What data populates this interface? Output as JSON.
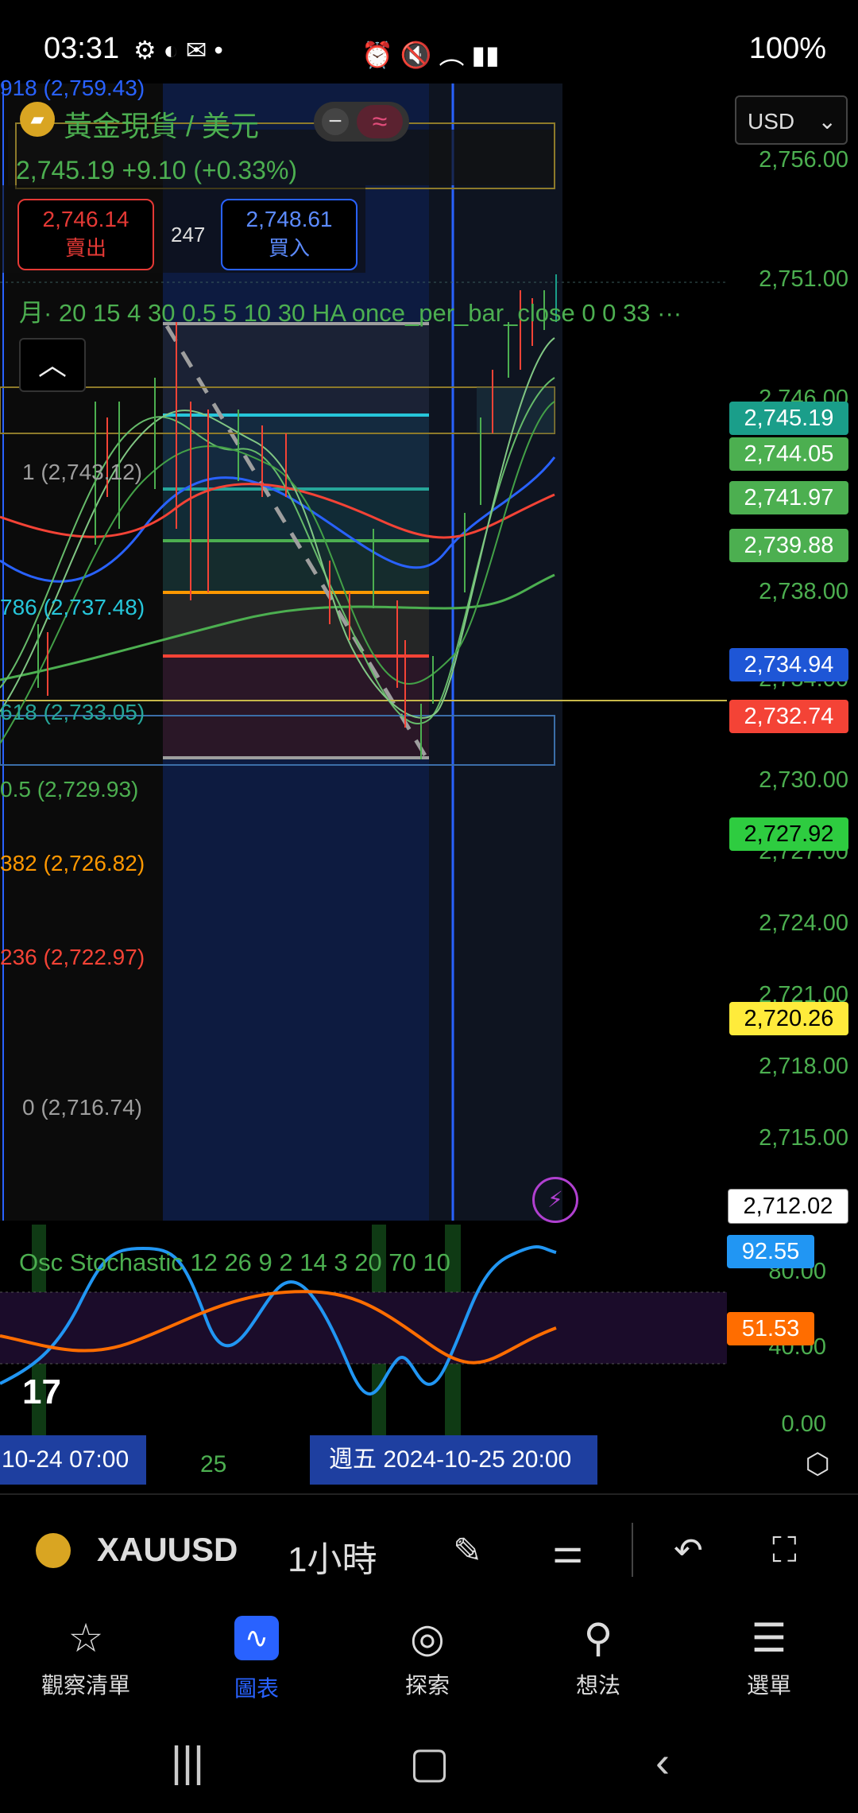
{
  "status_bar": {
    "time": "03:31",
    "battery": "100%",
    "icons": [
      "gear-icon",
      "discord-icon",
      "mail-icon",
      "dot",
      "alarm-icon",
      "mute-icon",
      "wifi-icon",
      "volte-icon",
      "signal-icon",
      "battery-icon"
    ]
  },
  "header": {
    "symbol_title": "黃金現貨 / 美元",
    "quote": "2,745.19  +9.10 (+0.33%)",
    "sell_price": "2,746.14",
    "sell_label": "賣出",
    "spread": "247",
    "buy_price": "2,748.61",
    "buy_label": "買入",
    "indicator": "月· 20 15 4 30 0.5 5 10 30 HA once_per_bar_close 0 0 33 ···",
    "currency": "USD",
    "top_cut_label": "918 (2,759.43)"
  },
  "price_axis": [
    "2,756.00",
    "2,751.00",
    "2,746.00",
    "2,738.00",
    "2,734.00",
    "2,730.00",
    "2,727.00",
    "2,724.00",
    "2,721.00",
    "2,718.00",
    "2,715.00"
  ],
  "price_tags": [
    {
      "value": "2,745.19",
      "color": "#1a9e8a",
      "text": "#fff"
    },
    {
      "value": "2,744.05",
      "color": "#4caf50",
      "text": "#fff"
    },
    {
      "value": "2,741.97",
      "color": "#4caf50",
      "text": "#fff"
    },
    {
      "value": "2,739.88",
      "color": "#4caf50",
      "text": "#fff"
    },
    {
      "value": "2,734.94",
      "color": "#1e56d6",
      "text": "#fff"
    },
    {
      "value": "2,732.74",
      "color": "#f44336",
      "text": "#fff"
    },
    {
      "value": "2,727.92",
      "color": "#2ecc40",
      "text": "#000"
    },
    {
      "value": "2,720.26",
      "color": "#ffeb3b",
      "text": "#000"
    },
    {
      "value": "2,712.02",
      "color": "#ffffff",
      "text": "#000"
    }
  ],
  "fib_levels": [
    {
      "label": "1 (2,743.12)",
      "color": "#9e9e9e"
    },
    {
      "label": "786 (2,737.48)",
      "color": "#26c6da"
    },
    {
      "label": "618 (2,733.05)",
      "color": "#26a69a"
    },
    {
      "label": "0.5 (2,729.93)",
      "color": "#4caf50"
    },
    {
      "label": "382 (2,726.82)",
      "color": "#ff9800"
    },
    {
      "label": "236 (2,722.97)",
      "color": "#f44336"
    },
    {
      "label": "0 (2,716.74)",
      "color": "#9e9e9e"
    }
  ],
  "oscillator": {
    "label": "Osc Stochastic 12 26 9 2 14 3 20 70 10",
    "axis": [
      "80.00",
      "40.00",
      "0.00"
    ],
    "tags": [
      {
        "value": "92.55",
        "color": "#2196f3"
      },
      {
        "value": "51.53",
        "color": "#ff6d00"
      }
    ]
  },
  "time_axis": {
    "left_badge": "10-24   07:00",
    "tick_25": "25",
    "center_badge": "週五 2024-10-25   20:00"
  },
  "toolbar": {
    "ticker": "XAUUSD",
    "interval": "1小時"
  },
  "bottom_nav": [
    {
      "label": "觀察清單",
      "icon": "star-icon"
    },
    {
      "label": "圖表",
      "icon": "chart-icon"
    },
    {
      "label": "探索",
      "icon": "compass-icon"
    },
    {
      "label": "想法",
      "icon": "lightbulb-icon"
    },
    {
      "label": "選單",
      "icon": "menu-icon"
    }
  ]
}
